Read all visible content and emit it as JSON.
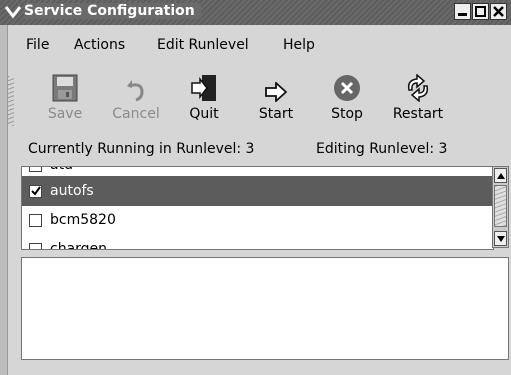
{
  "window": {
    "title": "Service Configuration"
  },
  "menubar": {
    "items": [
      {
        "label": "File"
      },
      {
        "label": "Actions"
      },
      {
        "label": "Edit Runlevel"
      },
      {
        "label": "Help"
      }
    ]
  },
  "toolbar": {
    "save_label": "Save",
    "cancel_label": "Cancel",
    "quit_label": "Quit",
    "start_label": "Start",
    "stop_label": "Stop",
    "restart_label": "Restart"
  },
  "status": {
    "running_label": "Currently Running in Runlevel: 3",
    "editing_label": "Editing Runlevel: 3"
  },
  "services": [
    {
      "name": "atd",
      "checked": false
    },
    {
      "name": "autofs",
      "checked": true,
      "selected": true
    },
    {
      "name": "bcm5820",
      "checked": false
    },
    {
      "name": "chargen",
      "checked": false
    }
  ],
  "colors": {
    "selection": "#5c5c5c",
    "titlebar": "#6a6a6a"
  }
}
